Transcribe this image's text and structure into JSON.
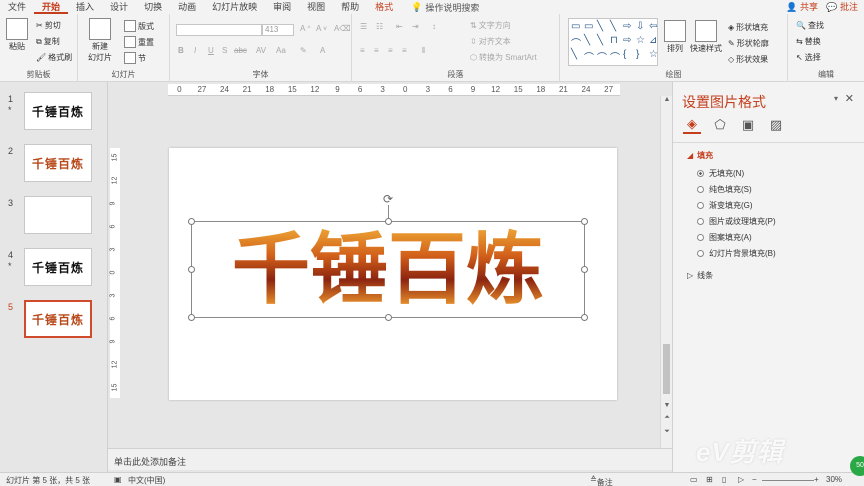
{
  "tabs": [
    "文件",
    "开始",
    "插入",
    "设计",
    "切换",
    "动画",
    "幻灯片放映",
    "审阅",
    "视图",
    "帮助",
    "格式"
  ],
  "tell_me": "操作说明搜索",
  "share": "共享",
  "comment": "批注",
  "ribbon": {
    "clipboard": {
      "label": "剪贴板",
      "paste": "粘贴",
      "cut": "剪切",
      "copy": "复制",
      "painter": "格式刷"
    },
    "slides": {
      "label": "幻灯片",
      "new": "新建",
      "new2": "幻灯片",
      "layout": "版式",
      "reset": "重置",
      "section": "节"
    },
    "font": {
      "label": "字体",
      "size": "413",
      "bold": "B",
      "italic": "I",
      "underline": "U",
      "shadow": "S",
      "strike": "abc",
      "spacing": "AV",
      "case": "Aa"
    },
    "paragraph": {
      "label": "段落",
      "direction": "文字方向",
      "align": "对齐文本",
      "smartart": "转换为 SmartArt"
    },
    "drawing": {
      "label": "绘图",
      "arrange": "排列",
      "quickstyle": "快速样式",
      "fill": "形状填充",
      "outline": "形状轮廓",
      "effect": "形状效果"
    },
    "edit": {
      "label": "编辑",
      "find": "查找",
      "replace": "替换",
      "select": "选择"
    }
  },
  "shapes": [
    "▭",
    "▭",
    "╲",
    "╲",
    "⇨",
    "⇩",
    "⇦",
    "⌒",
    "╲",
    "╲",
    "⊓",
    "⇨",
    "☆",
    "⊿",
    "╲",
    "⌒",
    "⌒",
    "⌒",
    "{",
    "}",
    "☆"
  ],
  "slides": [
    {
      "num": "1",
      "star": "*",
      "text": "千锤百炼",
      "style": "black"
    },
    {
      "num": "2",
      "star": "",
      "text": "千锤百炼",
      "style": "fire"
    },
    {
      "num": "3",
      "star": "",
      "text": "",
      "style": "black"
    },
    {
      "num": "4",
      "star": "*",
      "text": "千锤百炼",
      "style": "black"
    },
    {
      "num": "5",
      "star": "",
      "text": "千锤百炼",
      "style": "fire"
    }
  ],
  "hruler": [
    "0",
    "27",
    "24",
    "21",
    "18",
    "15",
    "12",
    "9",
    "6",
    "3",
    "0",
    "3",
    "6",
    "9",
    "12",
    "15",
    "18",
    "21",
    "24",
    "27"
  ],
  "vruler": [
    "15",
    "12",
    "9",
    "6",
    "3",
    "0",
    "3",
    "6",
    "9",
    "12",
    "15"
  ],
  "main_text": "千锤百炼",
  "notes": "单击此处添加备注",
  "pane": {
    "title": "设置图片格式",
    "fill_section": "填充",
    "options": [
      "无填充(N)",
      "纯色填充(S)",
      "渐变填充(G)",
      "图片或纹理填充(P)",
      "图案填充(A)",
      "幻灯片背景填充(B)"
    ],
    "line_section": "线条"
  },
  "status": {
    "slide": "幻灯片 第 5 张，共 5 张",
    "lang": "中文(中国)",
    "notes": "备注",
    "zoom": "30%"
  },
  "watermark": "eV剪辑",
  "colors": {
    "accent": "#c43e1c"
  }
}
